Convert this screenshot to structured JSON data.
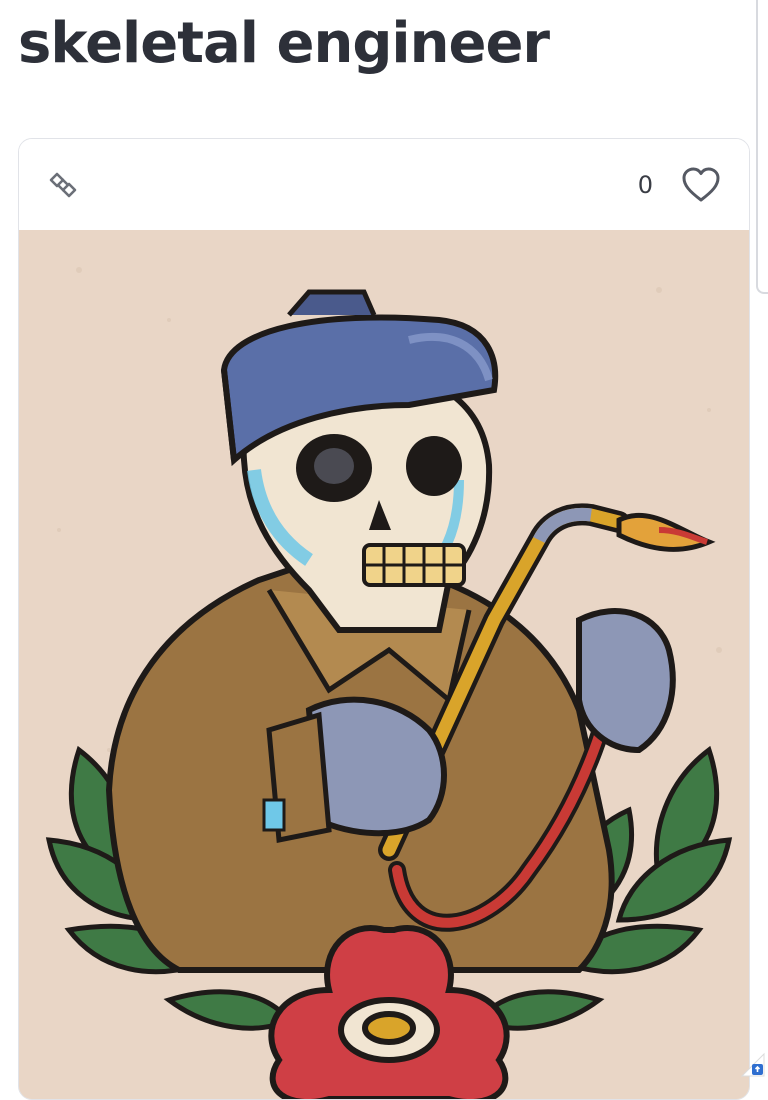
{
  "page": {
    "title": "skeletal engineer"
  },
  "card": {
    "link_icon": "link-icon",
    "like_count": "0",
    "like_icon": "heart-outline-icon",
    "artwork_alt": "Traditional tattoo flash of a skeleton welder holding a torch above a red flower and leaves"
  },
  "colors": {
    "title": "#2d3039",
    "paper": "#e9d6c6",
    "outline": "#1e1a18",
    "blue_shade": "#5a6fa8",
    "light_blue": "#6fc8e8",
    "brass": "#d9a42a",
    "hose_red": "#c93a35",
    "flower_red": "#cf3f45",
    "leaf_green": "#3f7a45",
    "jacket_brown": "#9b7442"
  }
}
